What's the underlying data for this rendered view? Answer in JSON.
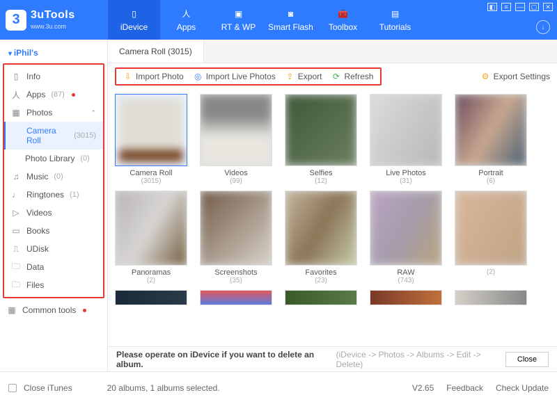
{
  "app": {
    "name": "3uTools",
    "site": "www.3u.com"
  },
  "topTabs": [
    {
      "label": "iDevice"
    },
    {
      "label": "Apps"
    },
    {
      "label": "RT & WP"
    },
    {
      "label": "Smart Flash"
    },
    {
      "label": "Toolbox"
    },
    {
      "label": "Tutorials"
    }
  ],
  "device": "iPhil's",
  "sidebar": [
    {
      "label": "Info",
      "count": ""
    },
    {
      "label": "Apps",
      "count": "(87)",
      "dot": true
    },
    {
      "label": "Photos",
      "count": "",
      "expand": true
    },
    {
      "label": "Camera Roll",
      "count": "(3015)",
      "sub": true,
      "active": true
    },
    {
      "label": "Photo Library",
      "count": "(0)",
      "sub": true
    },
    {
      "label": "Music",
      "count": "(0)"
    },
    {
      "label": "Ringtones",
      "count": "(1)"
    },
    {
      "label": "Videos",
      "count": ""
    },
    {
      "label": "Books",
      "count": ""
    },
    {
      "label": "UDisk",
      "count": ""
    },
    {
      "label": "Data",
      "count": ""
    },
    {
      "label": "Files",
      "count": ""
    }
  ],
  "commonTools": "Common tools",
  "pageTab": "Camera Roll (3015)",
  "toolbar": {
    "importPhoto": "Import Photo",
    "importLive": "Import Live Photos",
    "export": "Export",
    "refresh": "Refresh",
    "exportSettings": "Export Settings"
  },
  "albums": [
    {
      "label": "Camera Roll",
      "count": "(3015)",
      "sel": true,
      "cls": "cam"
    },
    {
      "label": "Videos",
      "count": "(99)",
      "cls": "g2"
    },
    {
      "label": "Selfies",
      "count": "(12)",
      "cls": "g3"
    },
    {
      "label": "Live Photos",
      "count": "(31)",
      "cls": "g4"
    },
    {
      "label": "Portrait",
      "count": "(6)",
      "cls": "g5"
    }
  ],
  "albums2": [
    {
      "label": "Panoramas",
      "count": "(2)",
      "cls": "g6"
    },
    {
      "label": "Screenshots",
      "count": "(35)",
      "cls": "g7"
    },
    {
      "label": "Favorites",
      "count": "(23)",
      "cls": "g8"
    },
    {
      "label": "RAW",
      "count": "(743)",
      "cls": "g9"
    },
    {
      "label": "",
      "count": "(2)",
      "cls": "g10"
    }
  ],
  "hint": {
    "text": "Please operate on iDevice if you want to delete an album.",
    "path": "(iDevice -> Photos -> Albums -> Edit -> Delete)",
    "close": "Close"
  },
  "footer": {
    "closeItunes": "Close iTunes",
    "status": "20 albums, 1 albums selected.",
    "version": "V2.65",
    "feedback": "Feedback",
    "update": "Check Update"
  }
}
